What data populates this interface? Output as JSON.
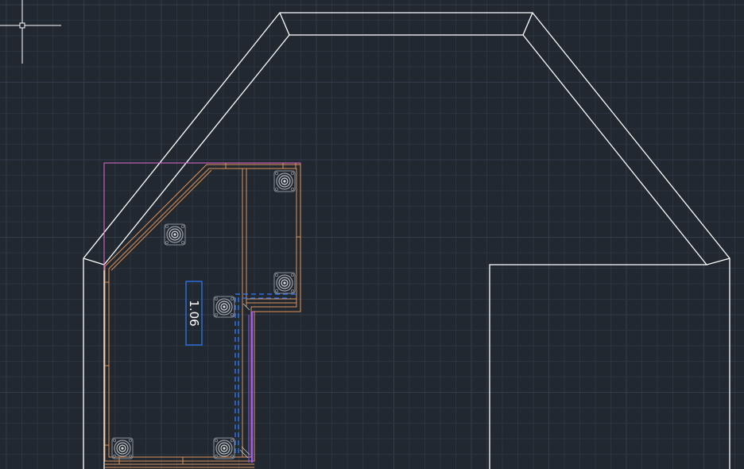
{
  "app": {
    "view": "cad-model-space-drawing"
  },
  "colors": {
    "background": "#212830",
    "grid_minor": "#2a3340",
    "grid_major": "#323c4a",
    "outline": "#ffffff",
    "cabinet": "#e0935a",
    "magenta": "#e26ad6",
    "purple": "#9a5cff",
    "dimension_blue": "#2f7bff",
    "crosshair": "#ffffff"
  },
  "dimension": {
    "value": "1.06"
  },
  "objects": {
    "crosshair_cursor": "crosshair-icon",
    "fitting_icon": "circular-fitting-icon"
  }
}
